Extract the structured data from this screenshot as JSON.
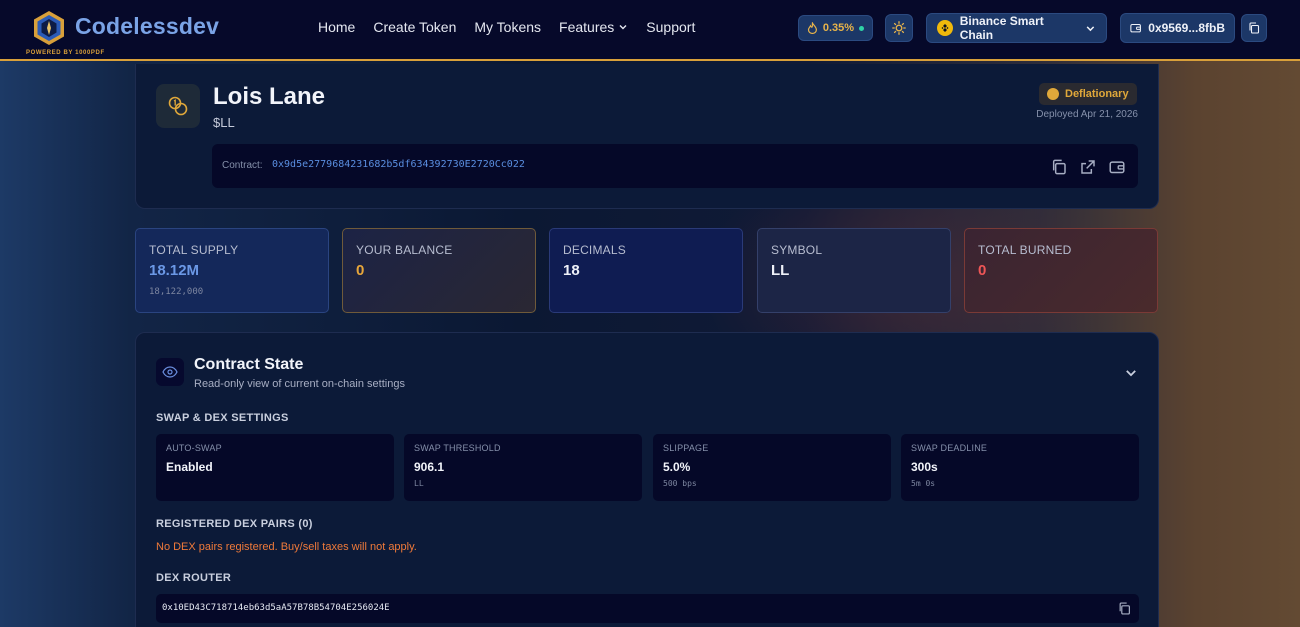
{
  "header": {
    "brand": "Codelessdev",
    "brand_sub": "POWERED BY 1000PDF",
    "nav": [
      "Home",
      "Create Token",
      "My Tokens",
      "Features",
      "Support"
    ],
    "fee": "0.35%",
    "chain": "Binance Smart Chain",
    "wallet": "0x9569...8fbB"
  },
  "token": {
    "name": "Lois Lane",
    "symbol": "$LL",
    "badge": "Deflationary",
    "deployed": "Deployed Apr 21, 2026",
    "contract_label": "Contract:",
    "contract_address": "0x9d5e2779684231682b5df634392730E2720Cc022"
  },
  "stats": [
    {
      "label": "TOTAL SUPPLY",
      "value": "18.12M",
      "sub": "18,122,000"
    },
    {
      "label": "YOUR BALANCE",
      "value": "0"
    },
    {
      "label": "DECIMALS",
      "value": "18"
    },
    {
      "label": "SYMBOL",
      "value": "LL"
    },
    {
      "label": "TOTAL BURNED",
      "value": "0"
    }
  ],
  "contract_state": {
    "title": "Contract State",
    "subtitle": "Read-only view of current on-chain settings",
    "swap_heading": "SWAP & DEX SETTINGS",
    "settings": [
      {
        "label": "AUTO-SWAP",
        "value": "Enabled",
        "sub": ""
      },
      {
        "label": "SWAP THRESHOLD",
        "value": "906.1",
        "sub": "LL"
      },
      {
        "label": "SLIPPAGE",
        "value": "5.0%",
        "sub": "500 bps"
      },
      {
        "label": "SWAP DEADLINE",
        "value": "300s",
        "sub": "5m 0s"
      }
    ],
    "pairs_heading": "REGISTERED DEX PAIRS (0)",
    "pairs_warning": "No DEX pairs registered. Buy/sell taxes will not apply.",
    "router_heading": "DEX ROUTER",
    "router_address": "0x10ED43C718714eb63d5aA57B78B54704E256024E"
  },
  "colors": {
    "accent_gold": "#d9a03a",
    "brand_blue": "#7aa3e6",
    "header_bg": "#06092a",
    "warning_orange": "#f07a3a",
    "burned_red": "#ef5656"
  }
}
